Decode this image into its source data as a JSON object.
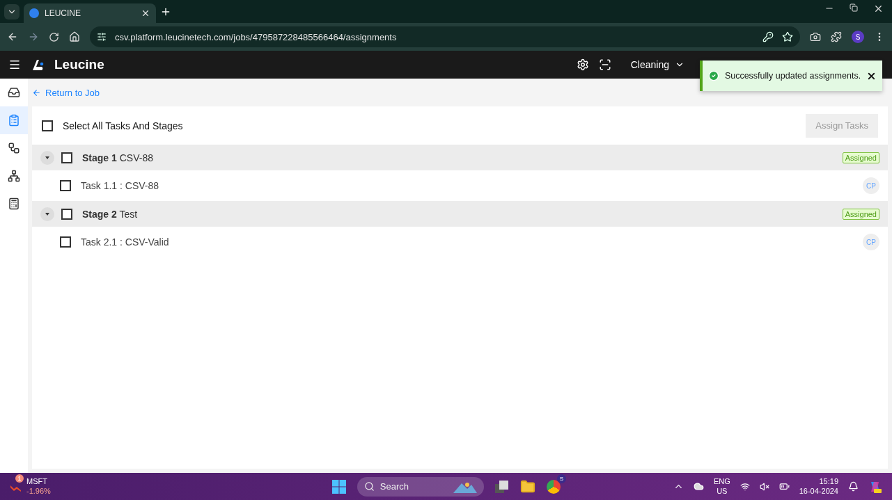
{
  "browser": {
    "tab_title": "LEUCINE",
    "url": "csv.platform.leucinetech.com/jobs/479587228485566464/assignments",
    "profile": "S"
  },
  "app": {
    "brand": "Leucine",
    "facility": "Cleaning"
  },
  "sidebar": {
    "items": [
      {
        "selected": false
      },
      {
        "selected": true
      },
      {
        "selected": false
      },
      {
        "selected": false
      },
      {
        "selected": false
      }
    ]
  },
  "toast": {
    "message": "Successfully updated assignments."
  },
  "back_link": "Return to Job",
  "select_all": {
    "label": "Select All Tasks And Stages",
    "checked": false
  },
  "assign_button": {
    "label": "Assign Tasks",
    "disabled": true
  },
  "stages": [
    {
      "number": "Stage 1",
      "name": "CSV-88",
      "checked": false,
      "expanded": true,
      "badge": "Assigned",
      "tasks": [
        {
          "label": "Task 1.1 : CSV-88",
          "checked": false,
          "assignee": "CP"
        }
      ]
    },
    {
      "number": "Stage 2",
      "name": "Test",
      "checked": false,
      "expanded": true,
      "badge": "Assigned",
      "tasks": [
        {
          "label": "Task 2.1 : CSV-Valid",
          "checked": false,
          "assignee": "CP"
        }
      ]
    }
  ],
  "taskbar": {
    "stock": "MSFT",
    "stock_change": "-1.96%",
    "stock_badge": "1",
    "search_placeholder": "Search",
    "chrome_badge": "S",
    "language": "ENG",
    "region": "US",
    "time": "15:19",
    "date": "16-04-2024"
  }
}
